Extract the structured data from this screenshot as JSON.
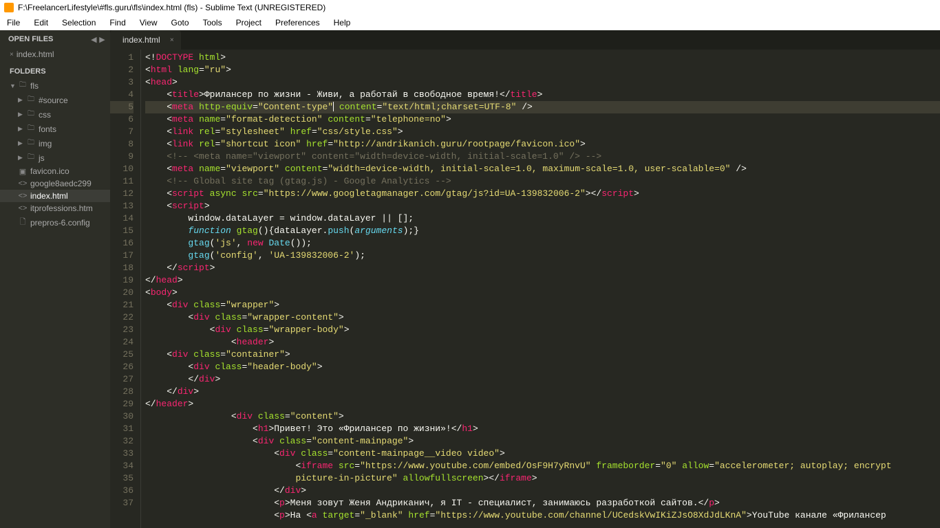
{
  "title": "F:\\FreelancerLifestyle\\#fls.guru\\fls\\index.html (fls) - Sublime Text (UNREGISTERED)",
  "menu": [
    "File",
    "Edit",
    "Selection",
    "Find",
    "View",
    "Goto",
    "Tools",
    "Project",
    "Preferences",
    "Help"
  ],
  "openfiles_label": "OPEN FILES",
  "openfiles": [
    "index.html"
  ],
  "folders_label": "FOLDERS",
  "tree": {
    "root": "fls",
    "dirs": [
      "#source",
      "css",
      "fonts",
      "img",
      "js"
    ],
    "files": [
      "favicon.ico",
      "google8aedc299",
      "index.html",
      "itprofessions.htm",
      "prepros-6.config"
    ]
  },
  "active_tab": "index.html",
  "lines": 37,
  "chart_data": null,
  "strings": {
    "doctype": "DOCTYPE",
    "html": "html",
    "lang": "lang",
    "ru": "\"ru\"",
    "head": "head",
    "title": "title",
    "title_text": "Фрилансер по жизни - Живи, а работай в свободное время!",
    "meta": "meta",
    "http_equiv": "http-equiv",
    "ct": "\"Content-type\"",
    "content": "content",
    "ctv": "\"text/html;charset=UTF-8\"",
    "name": "name",
    "fd": "\"format-detection\"",
    "tel": "\"telephone=no\"",
    "link": "link",
    "rel": "rel",
    "styl": "\"stylesheet\"",
    "href": "href",
    "css": "\"css/style.css\"",
    "short": "\"shortcut icon\"",
    "fav": "\"http://andrikanich.guru/rootpage/favicon.ico\"",
    "c1": "<!-- <meta name=\"viewport\" content=\"width=device-width, initial-scale=1.0\" /> -->",
    "vp": "\"viewport\"",
    "vpc": "\"width=device-width, initial-scale=1.0, maximum-scale=1.0, user-scalable=0\"",
    "c2": "<!-- Global site tag (gtag.js) - Google Analytics -->",
    "script": "script",
    "async": "async",
    "src": "src",
    "gtag": "\"https://www.googletagmanager.com/gtag/js?id=UA-139832006-2\"",
    "dl": "window.dataLayer = window.dataLayer || [];",
    "fn": "function",
    "gtagf": "gtag",
    "dlp": "dataLayer",
    "push": "push",
    "args": "arguments",
    "js": "'js'",
    "new": "new",
    "date": "Date",
    "cfg": "'config'",
    "ua": "'UA-139832006-2'",
    "body": "body",
    "div": "div",
    "class": "class",
    "wrap": "\"wrapper\"",
    "wc": "\"wrapper-content\"",
    "wb": "\"wrapper-body\"",
    "header": "header",
    "cont": "\"container\"",
    "hb": "\"header-body\"",
    "contcls": "\"content\"",
    "h1": "h1",
    "h1t": "Привет! Это «Фрилансер по жизни»!",
    "cmp": "\"content-mainpage\"",
    "cmpv": "\"content-mainpage__video video\"",
    "iframe": "iframe",
    "yt": "\"https://www.youtube.com/embed/OsF9H7yRnvU\"",
    "fb": "frameborder",
    "zero": "\"0\"",
    "allow": "allow",
    "allowv": "\"accelerometer; autoplay; encrypt",
    "pip": "picture-in-picture\"",
    "afs": "allowfullscreen",
    "p": "p",
    "pt": "Меня зовут Женя Андриканич, я IT - специалист, занимаюсь разработкой сайтов.",
    "ha": "На ",
    "a": "a",
    "target": "target",
    "blank": "\"_blank\"",
    "ytc": "\"https://www.youtube.com/channel/UCedskVwIKiZJsO8XdJdLKnA\"",
    "ytt": "YouTube канале «Фрилансер "
  }
}
